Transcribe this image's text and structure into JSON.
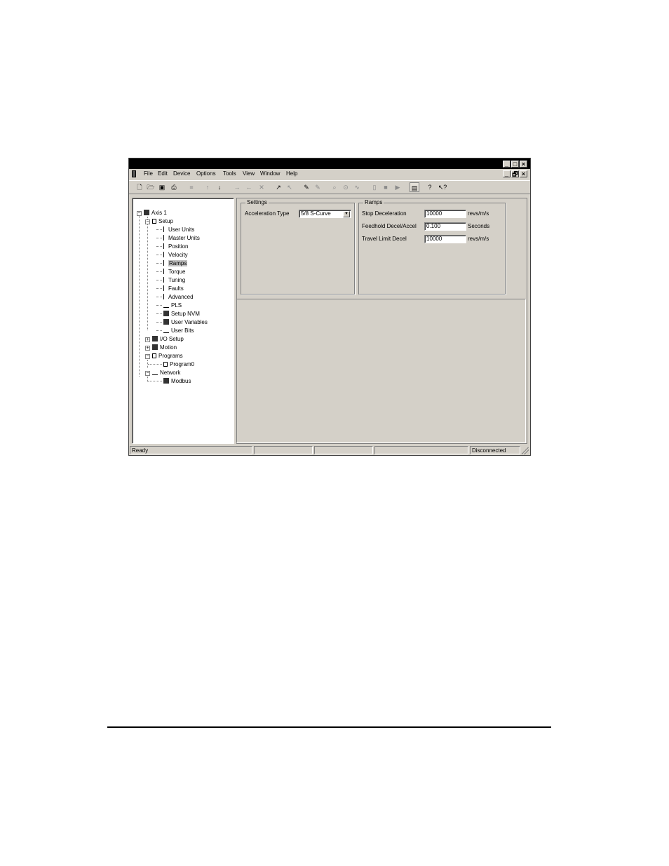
{
  "window": {
    "controls": [
      "_",
      "□",
      "×"
    ],
    "doc_controls": [
      "_",
      "🗗",
      "×"
    ]
  },
  "menu": [
    "File",
    "Edit",
    "Device",
    "Options",
    "Tools",
    "View",
    "Window",
    "Help"
  ],
  "toolbar": {
    "icons": [
      "new-icon",
      "open-icon",
      "save-icon",
      "print-icon",
      "export-icon",
      "upload-icon",
      "download-icon",
      "forward-icon",
      "back-icon",
      "cancel-icon",
      "step-icon",
      "step-back-icon",
      "edit-icon",
      "edit2-icon",
      "zoom-icon",
      "probe-icon",
      "scope-icon",
      "bookmark-icon",
      "stop-icon",
      "play-icon",
      "window-icon",
      "help-icon",
      "context-help-icon"
    ]
  },
  "tree": {
    "root": "Axis 1",
    "setup": "Setup",
    "setup_children": [
      "User Units",
      "Master Units",
      "Position",
      "Velocity",
      "Ramps",
      "Torque",
      "Tuning",
      "Faults",
      "Advanced",
      "PLS",
      "Setup NVM",
      "User Variables",
      "User Bits"
    ],
    "io_setup": "I/O Setup",
    "motion": "Motion",
    "programs": "Programs",
    "program0": "Program0",
    "network": "Network",
    "modbus": "Modbus",
    "selected": "Ramps"
  },
  "settings": {
    "title": "Settings",
    "accel_label": "Acceleration Type",
    "accel_value": "5/8 S-Curve"
  },
  "ramps": {
    "title": "Ramps",
    "stop_decel_label": "Stop Deceleration",
    "stop_decel_value": "10000",
    "stop_decel_unit": "revs/m/s",
    "feedhold_label": "Feedhold Decel/Accel",
    "feedhold_value": "0.100",
    "feedhold_unit": "Seconds",
    "travel_label": "Travel Limit Decel",
    "travel_value": "10000",
    "travel_unit": "revs/m/s"
  },
  "status": {
    "left": "Ready",
    "right": "Disconnected"
  }
}
